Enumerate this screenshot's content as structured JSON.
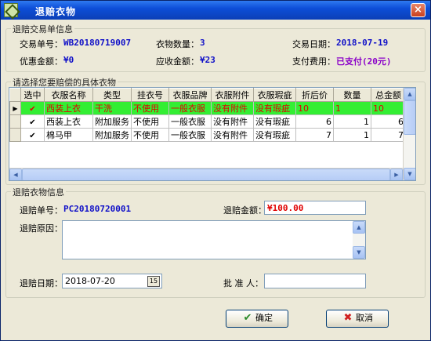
{
  "window": {
    "title": "退赔衣物",
    "close_label": "×"
  },
  "trade_group": {
    "legend": "退赔交易单信息",
    "order_no_label": "交易单号：",
    "order_no": "WB20180719007",
    "qty_label": "衣物数量：",
    "qty": "3",
    "date_label": "交易日期：",
    "date": "2018-07-19",
    "discount_label": "优惠金额：",
    "discount": "¥0",
    "receivable_label": "应收金额：",
    "receivable": "¥23",
    "payment_label": "支付费用：",
    "payment": "已支付(20元)"
  },
  "items_group": {
    "legend": "请选择您要赔偿的具体衣物",
    "columns": [
      "选中",
      "衣服名称",
      "类型",
      "挂衣号",
      "衣服品牌",
      "衣服附件",
      "衣服瑕疵",
      "折后价",
      "数量",
      "总金额"
    ],
    "rows": [
      {
        "checked": true,
        "name": "西装上衣",
        "type": "干洗",
        "hanger": "不使用",
        "brand": "一般衣服",
        "accessory": "没有附件",
        "defect": "没有瑕疵",
        "price": "10",
        "qty": "1",
        "total": "10",
        "selected": true
      },
      {
        "checked": true,
        "name": "西装上衣",
        "type": "附加服务",
        "hanger": "不使用",
        "brand": "一般衣服",
        "accessory": "没有附件",
        "defect": "没有瑕疵",
        "price": "6",
        "qty": "1",
        "total": "6",
        "selected": false
      },
      {
        "checked": true,
        "name": "棉马甲",
        "type": "附加服务",
        "hanger": "不使用",
        "brand": "一般衣服",
        "accessory": "没有附件",
        "defect": "没有瑕疵",
        "price": "7",
        "qty": "1",
        "total": "7",
        "selected": false
      }
    ]
  },
  "refund_group": {
    "legend": "退赔衣物信息",
    "refund_no_label": "退赔单号：",
    "refund_no": "PC20180720001",
    "amount_label": "退赔金额：",
    "amount": "¥100.00",
    "reason_label": "退赔原因：",
    "reason": "",
    "date_label": "退赔日期：",
    "date": "2018-07-20",
    "approver_label": "批 准 人：",
    "approver": ""
  },
  "buttons": {
    "ok": "确定",
    "cancel": "取消"
  },
  "colors": {
    "selected_row": "#33ee33",
    "selected_text": "#e00000",
    "value_blue": "#1010c8",
    "value_purple": "#8a00c8"
  }
}
